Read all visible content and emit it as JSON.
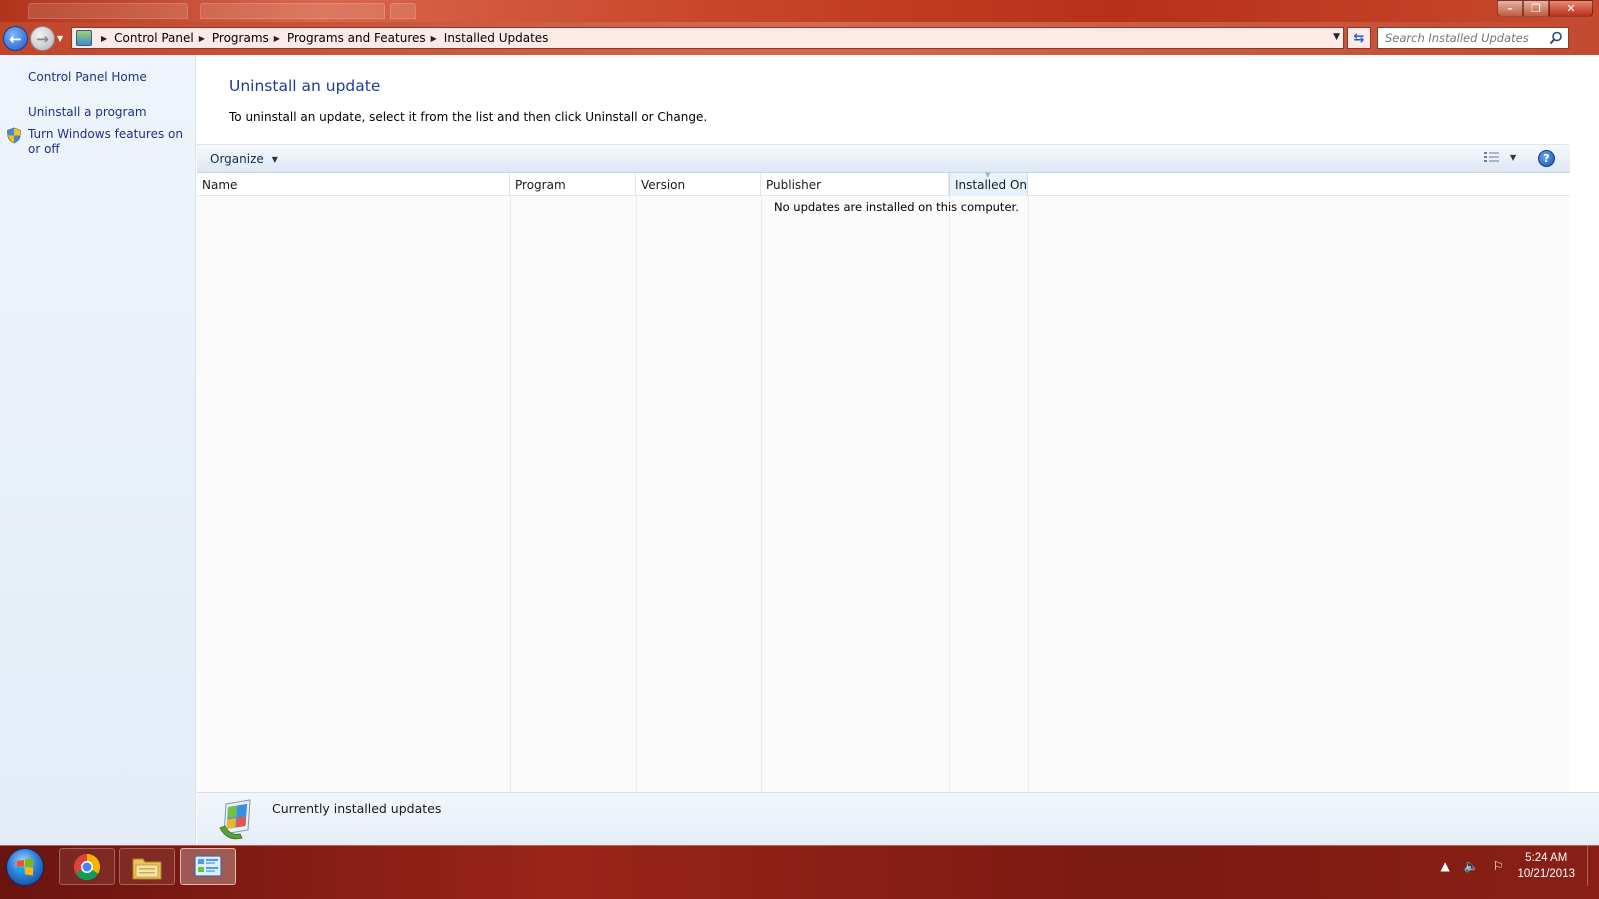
{
  "window": {
    "minimize_glyph": "–",
    "restore_glyph": "❐",
    "close_glyph": "✕"
  },
  "address_bar": {
    "breadcrumbs": [
      "Control Panel",
      "Programs",
      "Programs and Features",
      "Installed Updates"
    ],
    "search_placeholder": "Search Installed Updates"
  },
  "sidebar": {
    "links": [
      {
        "label": "Control Panel Home"
      },
      {
        "label": "Uninstall a program"
      },
      {
        "label": "Turn Windows features on or off",
        "icon": "uac-shield-icon"
      }
    ]
  },
  "main": {
    "title": "Uninstall an update",
    "description": "To uninstall an update, select it from the list and then click Uninstall or Change."
  },
  "toolbar": {
    "organize_label": "Organize",
    "views_icon": "views-icon",
    "help_label": "?"
  },
  "list": {
    "columns": [
      "Name",
      "Program",
      "Version",
      "Publisher",
      "Installed On"
    ],
    "sorted_column": "Installed On",
    "empty_message": "No updates are installed on this computer."
  },
  "details": {
    "text": "Currently installed updates",
    "icon": "installed-updates-icon"
  },
  "taskbar": {
    "pinned": [
      "start-button",
      "chrome-icon",
      "explorer-icon",
      "control-panel-icon"
    ],
    "active": "control-panel-icon",
    "time": "5:24 AM",
    "date": "10/21/2013"
  },
  "colors": {
    "accent_title": "#1e3c96",
    "link": "#1e3287",
    "frame": "#c0452b"
  }
}
